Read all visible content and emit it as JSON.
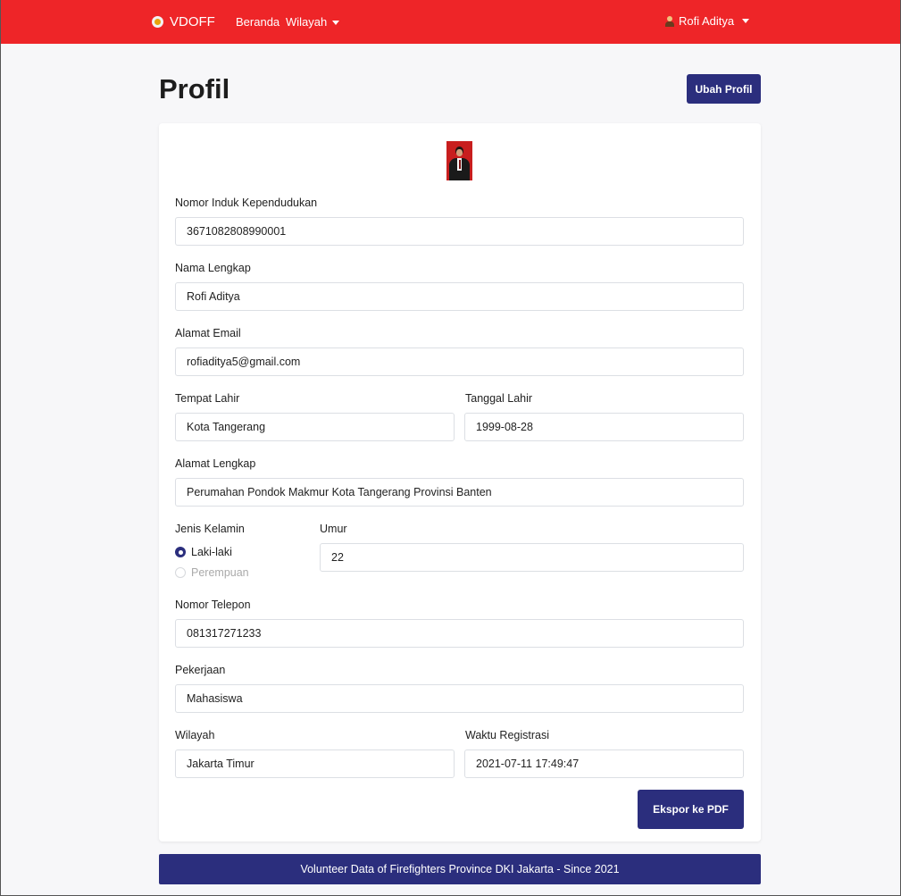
{
  "navbar": {
    "brand": "VDOFF",
    "links": {
      "home": "Beranda",
      "region": "Wilayah"
    },
    "user": "Rofi Aditya",
    "bg_color": "#ee2528"
  },
  "page": {
    "title": "Profil",
    "edit_button": "Ubah Profil",
    "export_button": "Ekspor ke PDF"
  },
  "form": {
    "nik": {
      "label": "Nomor Induk Kependudukan",
      "value": "3671082808990001"
    },
    "full_name": {
      "label": "Nama Lengkap",
      "value": "Rofi Aditya"
    },
    "email": {
      "label": "Alamat Email",
      "value": "rofiaditya5@gmail.com"
    },
    "birth_place": {
      "label": "Tempat Lahir",
      "value": "Kota Tangerang"
    },
    "birth_date": {
      "label": "Tanggal Lahir",
      "value": "1999-08-28"
    },
    "address": {
      "label": "Alamat Lengkap",
      "value": "Perumahan Pondok Makmur Kota Tangerang Provinsi Banten"
    },
    "gender": {
      "label": "Jenis Kelamin",
      "options": [
        "Laki-laki",
        "Perempuan"
      ],
      "selected": "Laki-laki"
    },
    "age": {
      "label": "Umur",
      "value": "22"
    },
    "phone": {
      "label": "Nomor Telepon",
      "value": "081317271233"
    },
    "job": {
      "label": "Pekerjaan",
      "value": "Mahasiswa"
    },
    "region": {
      "label": "Wilayah",
      "value": "Jakarta Timur"
    },
    "registered": {
      "label": "Waktu Registrasi",
      "value": "2021-07-11 17:49:47"
    }
  },
  "footer": {
    "text": "Volunteer Data of Firefighters Province DKI Jakarta - Since 2021",
    "bg_color": "#2b2e7d"
  }
}
